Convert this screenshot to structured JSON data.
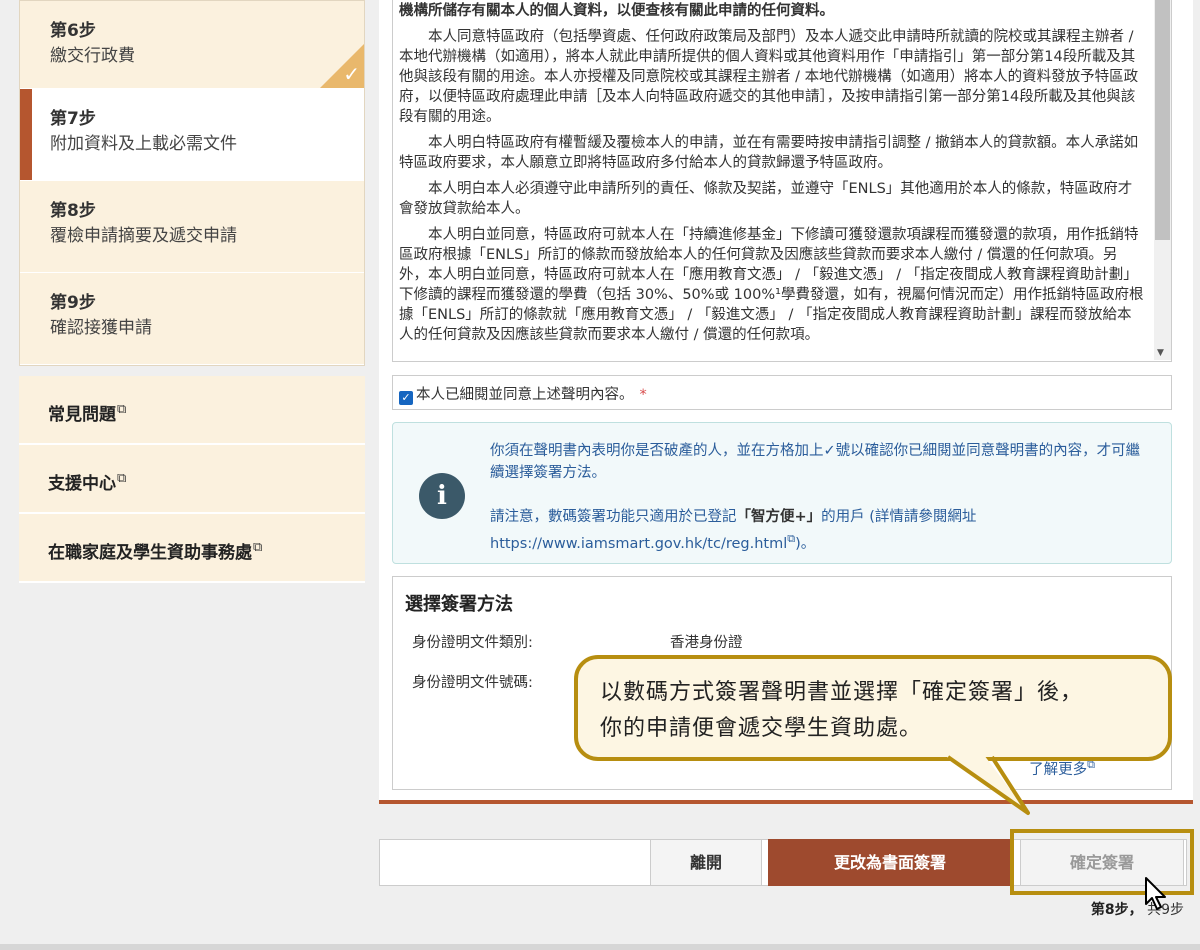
{
  "sidebar": {
    "steps": [
      {
        "num": "第6步",
        "title": "繳交行政費",
        "state": "completed"
      },
      {
        "num": "第7步",
        "title": "附加資料及上載必需文件",
        "state": "active"
      },
      {
        "num": "第8步",
        "title": "覆檢申請摘要及遞交申請",
        "state": "pending"
      },
      {
        "num": "第9步",
        "title": "確認接獲申請",
        "state": "pending"
      }
    ],
    "links": [
      {
        "label": "常見問題"
      },
      {
        "label": "支援中心"
      },
      {
        "label": "在職家庭及學生資助事務處"
      }
    ],
    "check_glyph": "✓",
    "ext_glyph": "⧉"
  },
  "declaration": {
    "heading": "機構所儲存有關本人的個人資料，以便查核有關此申請的任何資料。",
    "paragraphs": [
      "本人同意特區政府（包括學資處、任何政府政策局及部門）及本人遞交此申請時所就讀的院校或其課程主辦者 / 本地代辦機構（如適用），將本人就此申請所提供的個人資料或其他資料用作「申請指引」第一部分第14段所載及其他與該段有關的用途。本人亦授權及同意院校或其課程主辦者 / 本地代辦機構（如適用）將本人的資料發放予特區政府，以便特區政府處理此申請［及本人向特區政府遞交的其他申請］，及按申請指引第一部分第14段所載及其他與該段有關的用途。",
      "本人明白特區政府有權暫緩及覆檢本人的申請，並在有需要時按申請指引調整 / 撤銷本人的貸款額。本人承諾如特區政府要求，本人願意立即將特區政府多付給本人的貸款歸還予特區政府。",
      "本人明白本人必須遵守此申請所列的責任、條款及契諾，並遵守「ENLS」其他適用於本人的條款，特區政府才會發放貸款給本人。",
      "本人明白並同意，特區政府可就本人在「持續進修基金」下修讀可獲發還款項課程而獲發還的款項，用作抵銷特區政府根據「ENLS」所訂的條款而發放給本人的任何貸款及因應該些貸款而要求本人繳付 / 償還的任何款項。另外，本人明白並同意，特區政府可就本人在「應用教育文憑」 / 「毅進文憑」 / 「指定夜間成人教育課程資助計劃」下修讀的課程而獲發還的學費（包括 30%、50%或 100%¹學費發還，如有，視屬何情況而定）用作抵銷特區政府根據「ENLS」所訂的條款就「應用教育文憑」 / 「毅進文憑」 / 「指定夜間成人教育課程資助計劃」課程而發放給本人的任何貸款及因應該些貸款而要求本人繳付 / 償還的任何款項。"
    ]
  },
  "agree": {
    "label": "本人已細閱並同意上述聲明內容。",
    "required_mark": "*",
    "checked": true
  },
  "info": {
    "line1": "你須在聲明書內表明你是否破產的人，並在方格加上✓號以確認你已細閱並同意聲明書的內容，才可繼續選擇簽署方法。",
    "line2_prefix": "請注意，數碼簽署功能只適用於已登記",
    "line2_brand": "「智方便+」",
    "line2_suffix": "的用戶 (詳情請參閱網址",
    "url": "https://www.iamsmart.gov.hk/tc/reg.html",
    "url_close": ")。"
  },
  "sign": {
    "title": "選擇簽署方法",
    "doc_type_label": "身份證明文件類別:",
    "doc_type_value": "香港身份證",
    "doc_no_label": "身份證明文件號碼:",
    "more_link": "了解更多"
  },
  "callout": {
    "line1": "以數碼方式簽署聲明書並選擇「確定簽署」後，",
    "line2": "你的申請便會遞交學生資助處。"
  },
  "footer": {
    "leave_label": "離開",
    "paper_sign_label": "更改為書面簽署",
    "confirm_label": "確定簽署",
    "step_current": "第8步，",
    "step_total": "共9步"
  },
  "colors": {
    "accent": "#b5562f",
    "button_primary": "#9e4a2e",
    "callout_border": "#b78e10",
    "info_text": "#2b5d9b"
  }
}
